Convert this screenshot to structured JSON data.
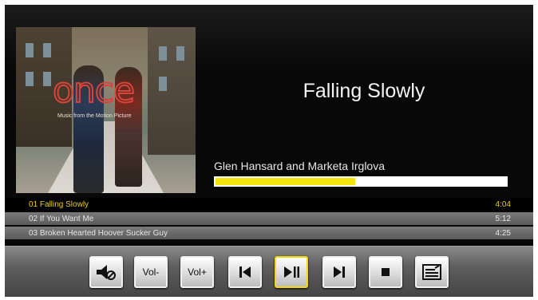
{
  "now_playing": {
    "title": "Falling Slowly",
    "artist": "Glen Hansard and Marketa Irglova",
    "progress": 0.48
  },
  "album": {
    "logo": "once",
    "tagline": "Music from the Motion Picture"
  },
  "playlist": [
    {
      "name": "01 Falling Slowly",
      "duration": "4:04",
      "active": true
    },
    {
      "name": "02 If You Want Me",
      "duration": "5:12",
      "active": false
    },
    {
      "name": "03 Broken Hearted Hoover Sucker Guy",
      "duration": "4:25",
      "active": false
    }
  ],
  "controls": {
    "mute": {
      "icon": "mute-speaker-icon"
    },
    "vol_down": {
      "label": "Vol-"
    },
    "vol_up": {
      "label": "Vol+"
    },
    "prev": {
      "icon": "previous-track-icon"
    },
    "play_pause": {
      "icon": "play-pause-icon",
      "selected": true
    },
    "next": {
      "icon": "next-track-icon"
    },
    "stop": {
      "icon": "stop-icon"
    },
    "playlist": {
      "icon": "playlist-menu-icon"
    }
  },
  "colors": {
    "accent": "#f2e40c",
    "active_row_text": "#f0d010",
    "background": "#080808"
  }
}
